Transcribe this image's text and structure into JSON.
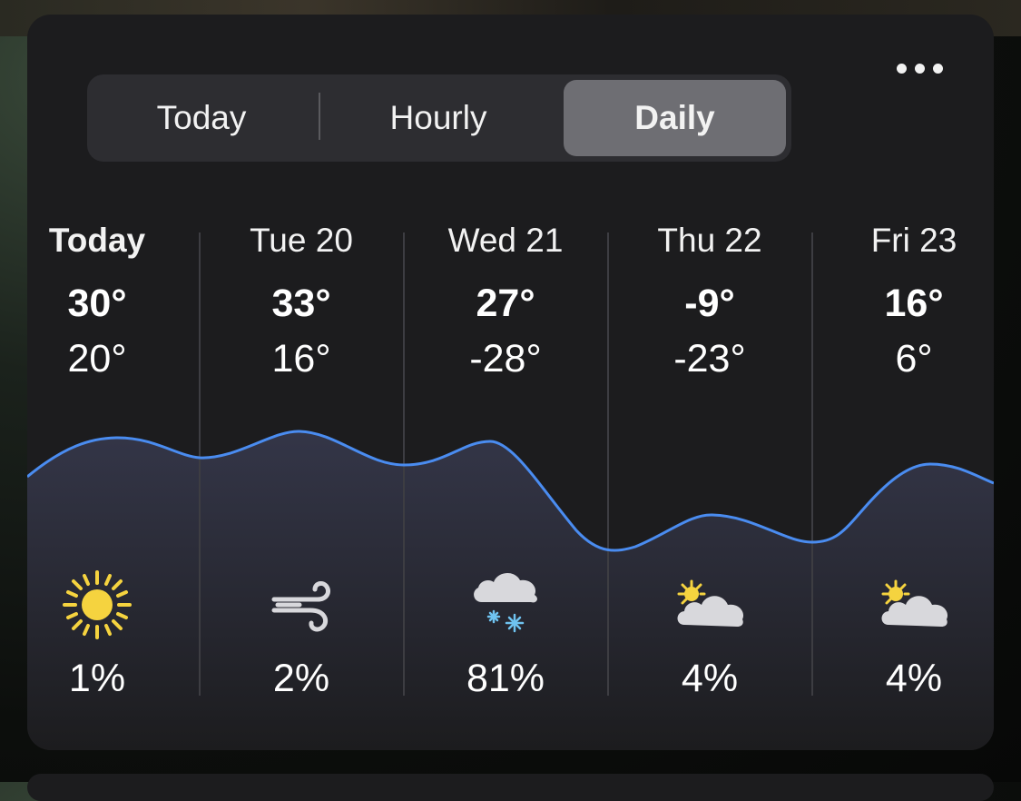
{
  "tabs": [
    {
      "label": "Today",
      "selected": false
    },
    {
      "label": "Hourly",
      "selected": false
    },
    {
      "label": "Daily",
      "selected": true
    }
  ],
  "more_button": "more-options-icon",
  "days": [
    {
      "label": "Today",
      "high": "30°",
      "low": "20°",
      "icon": "sun-icon",
      "precip": "1%"
    },
    {
      "label": "Tue 20",
      "high": "33°",
      "low": "16°",
      "icon": "wind-icon",
      "precip": "2%"
    },
    {
      "label": "Wed 21",
      "high": "27°",
      "low": "-28°",
      "icon": "cloud-snow-icon",
      "precip": "81%"
    },
    {
      "label": "Thu 22",
      "high": "-9°",
      "low": "-23°",
      "icon": "partly-cloudy-icon",
      "precip": "4%"
    },
    {
      "label": "Fri 23",
      "high": "16°",
      "low": "6°",
      "icon": "partly-cloudy-icon",
      "precip": "4%"
    }
  ],
  "colors": {
    "card": "#1c1c1e",
    "line": "#4a8cf0",
    "sun": "#f5d33f",
    "cloud": "#d8d8dc",
    "snow": "#6fc3f0"
  }
}
